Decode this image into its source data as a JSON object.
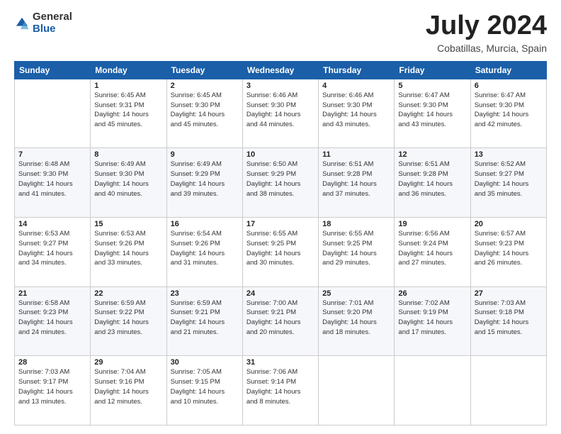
{
  "header": {
    "logo_general": "General",
    "logo_blue": "Blue",
    "month_title": "July 2024",
    "location": "Cobatillas, Murcia, Spain"
  },
  "calendar": {
    "days_of_week": [
      "Sunday",
      "Monday",
      "Tuesday",
      "Wednesday",
      "Thursday",
      "Friday",
      "Saturday"
    ],
    "weeks": [
      [
        {
          "day": "",
          "content": ""
        },
        {
          "day": "1",
          "content": "Sunrise: 6:45 AM\nSunset: 9:31 PM\nDaylight: 14 hours\nand 45 minutes."
        },
        {
          "day": "2",
          "content": "Sunrise: 6:45 AM\nSunset: 9:30 PM\nDaylight: 14 hours\nand 45 minutes."
        },
        {
          "day": "3",
          "content": "Sunrise: 6:46 AM\nSunset: 9:30 PM\nDaylight: 14 hours\nand 44 minutes."
        },
        {
          "day": "4",
          "content": "Sunrise: 6:46 AM\nSunset: 9:30 PM\nDaylight: 14 hours\nand 43 minutes."
        },
        {
          "day": "5",
          "content": "Sunrise: 6:47 AM\nSunset: 9:30 PM\nDaylight: 14 hours\nand 43 minutes."
        },
        {
          "day": "6",
          "content": "Sunrise: 6:47 AM\nSunset: 9:30 PM\nDaylight: 14 hours\nand 42 minutes."
        }
      ],
      [
        {
          "day": "7",
          "content": "Sunrise: 6:48 AM\nSunset: 9:30 PM\nDaylight: 14 hours\nand 41 minutes."
        },
        {
          "day": "8",
          "content": "Sunrise: 6:49 AM\nSunset: 9:30 PM\nDaylight: 14 hours\nand 40 minutes."
        },
        {
          "day": "9",
          "content": "Sunrise: 6:49 AM\nSunset: 9:29 PM\nDaylight: 14 hours\nand 39 minutes."
        },
        {
          "day": "10",
          "content": "Sunrise: 6:50 AM\nSunset: 9:29 PM\nDaylight: 14 hours\nand 38 minutes."
        },
        {
          "day": "11",
          "content": "Sunrise: 6:51 AM\nSunset: 9:28 PM\nDaylight: 14 hours\nand 37 minutes."
        },
        {
          "day": "12",
          "content": "Sunrise: 6:51 AM\nSunset: 9:28 PM\nDaylight: 14 hours\nand 36 minutes."
        },
        {
          "day": "13",
          "content": "Sunrise: 6:52 AM\nSunset: 9:27 PM\nDaylight: 14 hours\nand 35 minutes."
        }
      ],
      [
        {
          "day": "14",
          "content": "Sunrise: 6:53 AM\nSunset: 9:27 PM\nDaylight: 14 hours\nand 34 minutes."
        },
        {
          "day": "15",
          "content": "Sunrise: 6:53 AM\nSunset: 9:26 PM\nDaylight: 14 hours\nand 33 minutes."
        },
        {
          "day": "16",
          "content": "Sunrise: 6:54 AM\nSunset: 9:26 PM\nDaylight: 14 hours\nand 31 minutes."
        },
        {
          "day": "17",
          "content": "Sunrise: 6:55 AM\nSunset: 9:25 PM\nDaylight: 14 hours\nand 30 minutes."
        },
        {
          "day": "18",
          "content": "Sunrise: 6:55 AM\nSunset: 9:25 PM\nDaylight: 14 hours\nand 29 minutes."
        },
        {
          "day": "19",
          "content": "Sunrise: 6:56 AM\nSunset: 9:24 PM\nDaylight: 14 hours\nand 27 minutes."
        },
        {
          "day": "20",
          "content": "Sunrise: 6:57 AM\nSunset: 9:23 PM\nDaylight: 14 hours\nand 26 minutes."
        }
      ],
      [
        {
          "day": "21",
          "content": "Sunrise: 6:58 AM\nSunset: 9:23 PM\nDaylight: 14 hours\nand 24 minutes."
        },
        {
          "day": "22",
          "content": "Sunrise: 6:59 AM\nSunset: 9:22 PM\nDaylight: 14 hours\nand 23 minutes."
        },
        {
          "day": "23",
          "content": "Sunrise: 6:59 AM\nSunset: 9:21 PM\nDaylight: 14 hours\nand 21 minutes."
        },
        {
          "day": "24",
          "content": "Sunrise: 7:00 AM\nSunset: 9:21 PM\nDaylight: 14 hours\nand 20 minutes."
        },
        {
          "day": "25",
          "content": "Sunrise: 7:01 AM\nSunset: 9:20 PM\nDaylight: 14 hours\nand 18 minutes."
        },
        {
          "day": "26",
          "content": "Sunrise: 7:02 AM\nSunset: 9:19 PM\nDaylight: 14 hours\nand 17 minutes."
        },
        {
          "day": "27",
          "content": "Sunrise: 7:03 AM\nSunset: 9:18 PM\nDaylight: 14 hours\nand 15 minutes."
        }
      ],
      [
        {
          "day": "28",
          "content": "Sunrise: 7:03 AM\nSunset: 9:17 PM\nDaylight: 14 hours\nand 13 minutes."
        },
        {
          "day": "29",
          "content": "Sunrise: 7:04 AM\nSunset: 9:16 PM\nDaylight: 14 hours\nand 12 minutes."
        },
        {
          "day": "30",
          "content": "Sunrise: 7:05 AM\nSunset: 9:15 PM\nDaylight: 14 hours\nand 10 minutes."
        },
        {
          "day": "31",
          "content": "Sunrise: 7:06 AM\nSunset: 9:14 PM\nDaylight: 14 hours\nand 8 minutes."
        },
        {
          "day": "",
          "content": ""
        },
        {
          "day": "",
          "content": ""
        },
        {
          "day": "",
          "content": ""
        }
      ]
    ]
  }
}
